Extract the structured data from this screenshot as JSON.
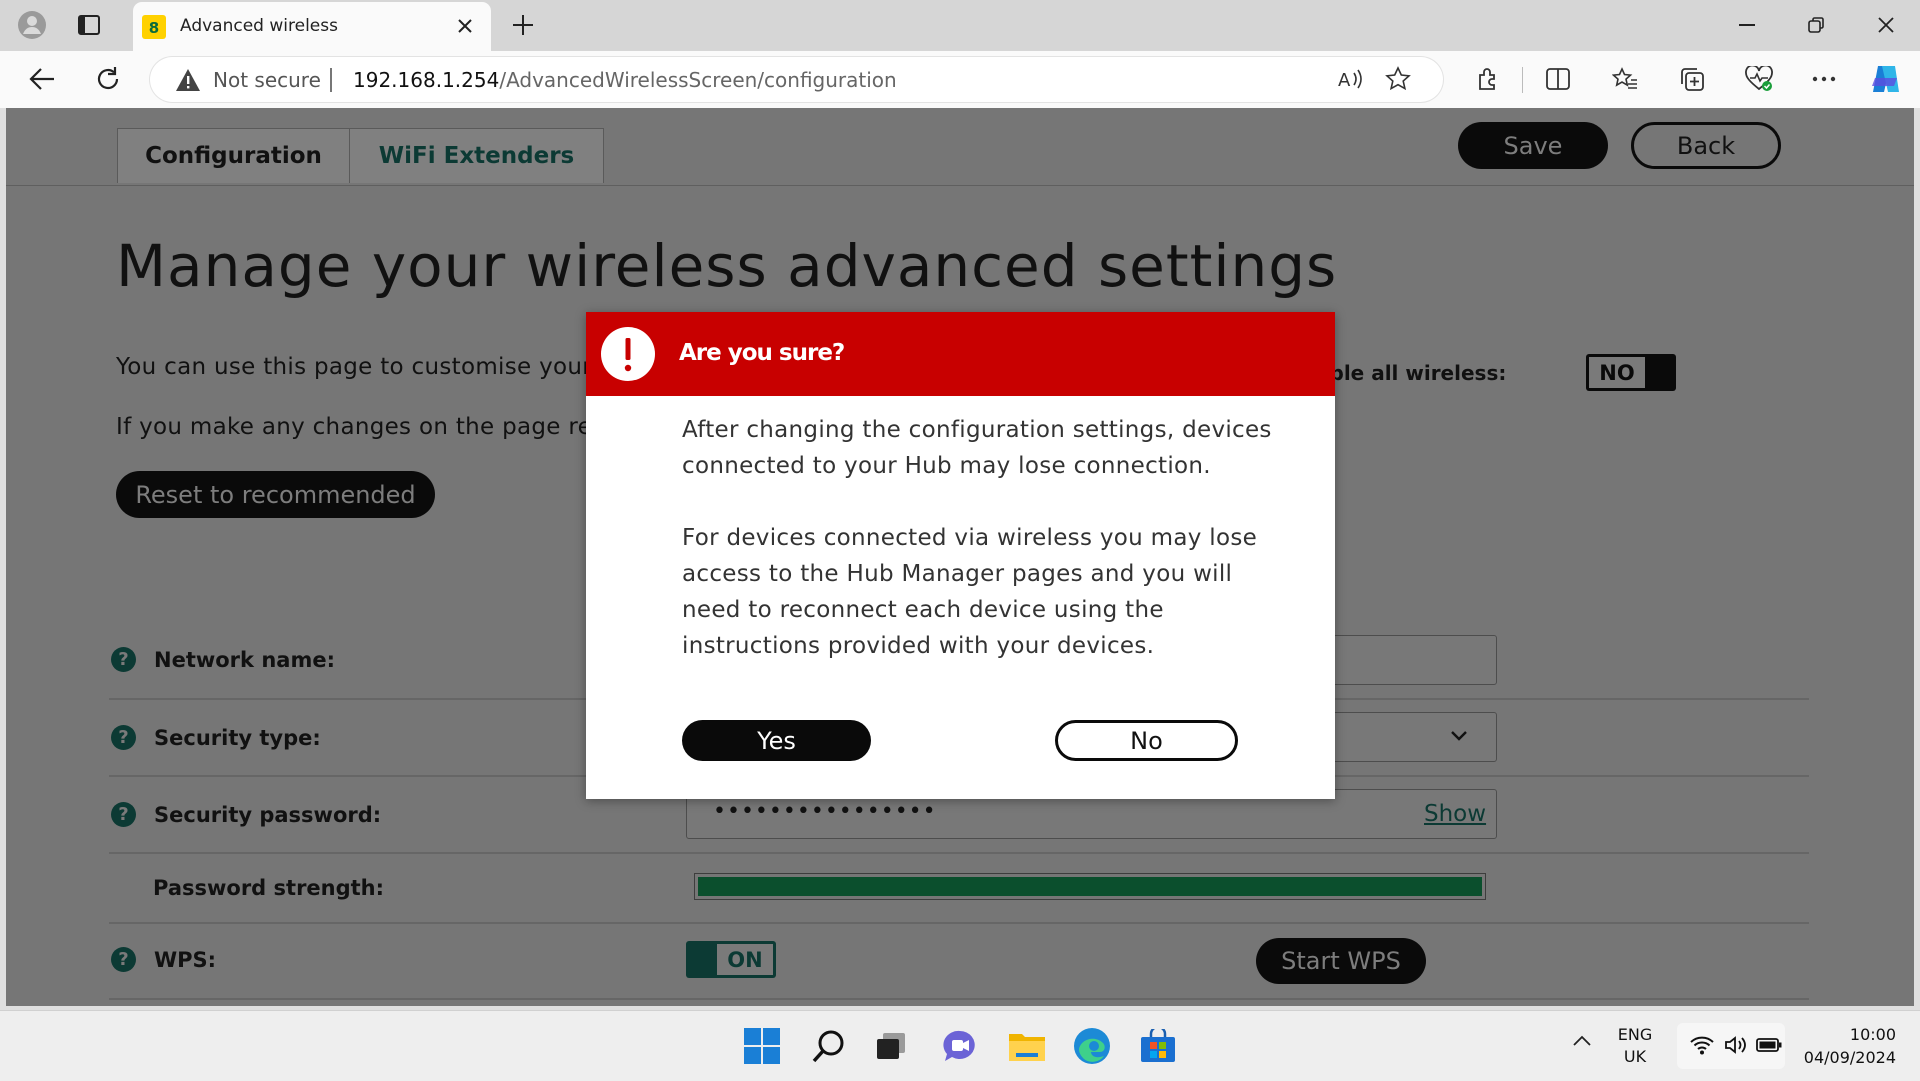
{
  "browser": {
    "tab_title": "Advanced wireless",
    "security_label": "Not secure",
    "url_host": "192.168.1.254",
    "url_path": "/AdvancedWirelessScreen/configuration",
    "icons": [
      "profile-icon",
      "tab-actions-icon",
      "favicon",
      "close-tab-icon",
      "new-tab-icon",
      "minimize-icon",
      "restore-icon",
      "close-window-icon",
      "back-icon",
      "refresh-icon",
      "warning-icon",
      "read-aloud-icon",
      "favorite-star-icon",
      "extensions-icon",
      "split-screen-icon",
      "favorites-icon",
      "collections-icon",
      "browser-essentials-icon",
      "more-icon",
      "copilot-icon"
    ]
  },
  "page": {
    "tabs": [
      "Configuration",
      "WiFi Extenders"
    ],
    "save_label": "Save",
    "back_label": "Back",
    "heading": "Manage your wireless advanced settings",
    "intro_1": "You can use this page to customise your w",
    "intro_2": "If you make any changes on the page rem",
    "reset_label": "Reset to recommended",
    "disable_wireless_label": "able all wireless:",
    "disable_wireless_value": "NO",
    "fields": {
      "network_name": "Network name:",
      "security_type": "Security type:",
      "security_password": "Security password:",
      "password_value": "••••••••••••••••",
      "show_label": "Show",
      "password_strength": "Password strength:",
      "password_strength_level": 1.0,
      "wps": "WPS:",
      "wps_value": "ON",
      "start_wps_label": "Start WPS"
    }
  },
  "modal": {
    "title": "Are you sure?",
    "paragraph_1": "After changing the configuration settings, devices connected to your Hub may lose connection.",
    "paragraph_2": "For devices connected via wireless you may lose access to the Hub Manager pages and you will need to reconnect each device using the instructions provided with your devices.",
    "yes_label": "Yes",
    "no_label": "No"
  },
  "taskbar": {
    "language_1": "ENG",
    "language_2": "UK",
    "time": "10:00",
    "date": "04/09/2024"
  },
  "colors": {
    "modal_header": "#c80000",
    "page_overlay": "#767676",
    "teal_accent": "#0c3a34",
    "strength_bar": "#0b6a3a"
  }
}
